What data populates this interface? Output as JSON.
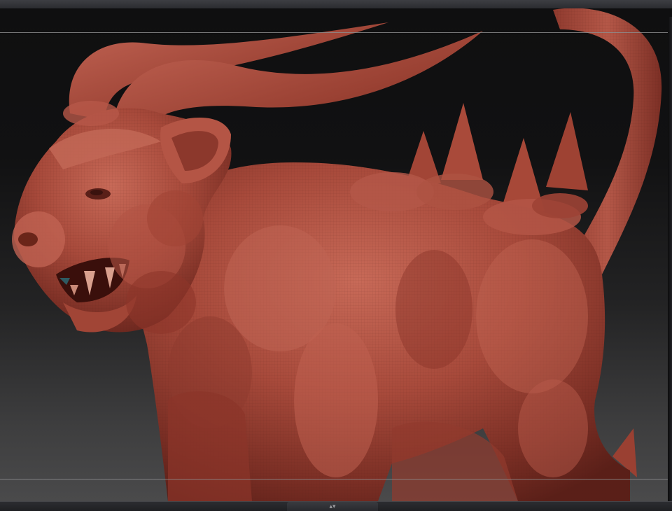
{
  "window": {
    "title": ""
  },
  "viewport": {
    "subject": "demon-lion-sculpt",
    "material_color": "#a84a3b",
    "background_top": "#0f0f10",
    "background_bottom": "#4a4a4b",
    "frame_line_color": "#8d8d8f"
  },
  "bottom_bar": {
    "grip_icon": "▴▾"
  }
}
